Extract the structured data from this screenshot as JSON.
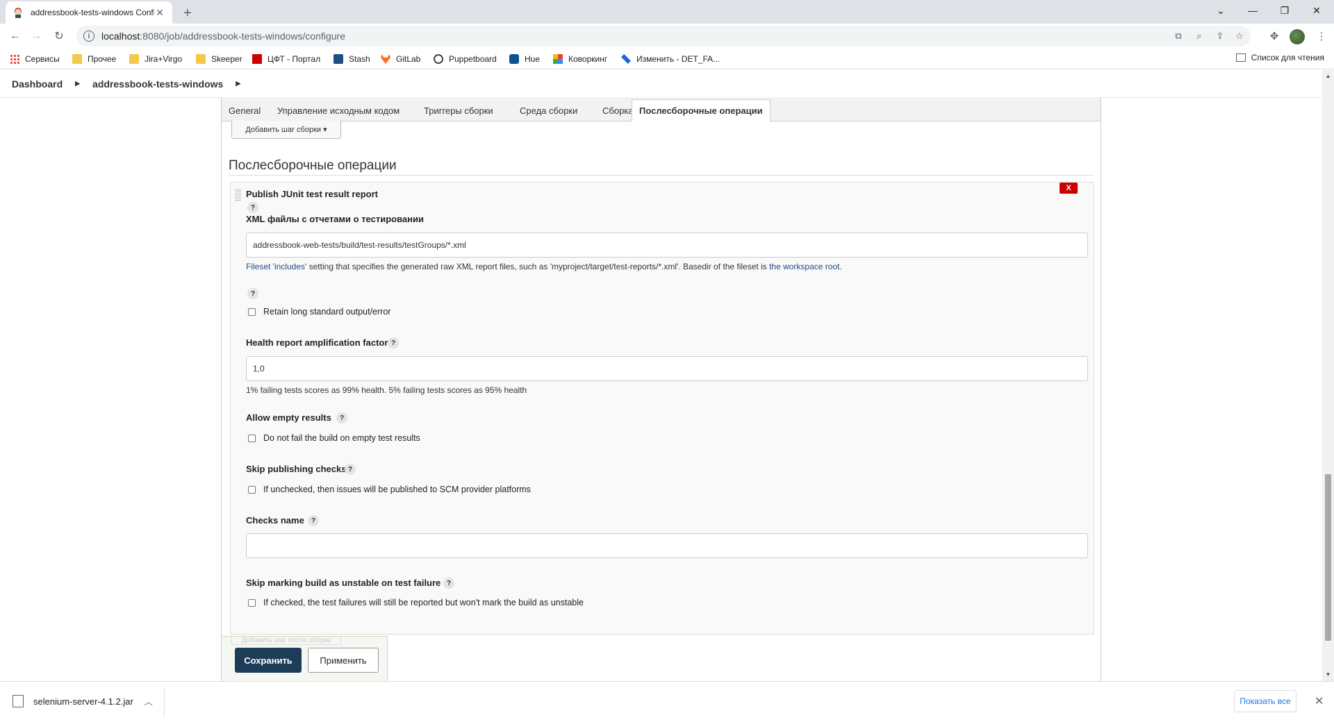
{
  "browser": {
    "tab_title": "addressbook-tests-windows Config",
    "url_host": "localhost",
    "url_path": ":8080/job/addressbook-tests-windows/configure",
    "bookmarks": [
      "Сервисы",
      "Прочее",
      "Jira+Virgo",
      "Skeeper",
      "ЦФТ - Портал",
      "Stash",
      "GitLab",
      "Puppetboard",
      "Hue",
      "Коворкинг",
      "Изменить - DET_FA..."
    ],
    "reading_list": "Список для чтения"
  },
  "breadcrumb": {
    "dashboard": "Dashboard",
    "job": "addressbook-tests-windows"
  },
  "tabs": [
    "General",
    "Управление исходным кодом",
    "Триггеры сборки",
    "Среда сборки",
    "Сборка",
    "Послесборочные операции"
  ],
  "add_build_step": "Добавить шаг сборки",
  "section_title": "Послесборочные операции",
  "publisher": {
    "title": "Publish JUnit test result report",
    "delete_label": "X",
    "help": "?",
    "xml_label": "XML файлы с отчетами о тестировании",
    "xml_value": "addressbook-web-tests/build/test-results/testGroups/*.xml",
    "xml_desc_link1": "Fileset 'includes'",
    "xml_desc_mid": " setting that specifies the generated raw XML report files, such as 'myproject/target/test-reports/*.xml'. Basedir of the fileset is ",
    "xml_desc_link2": "the workspace root",
    "xml_desc_end": ".",
    "retain_label": "Retain long standard output/error",
    "health_label": "Health report amplification factor",
    "health_value": "1,0",
    "health_desc": "1% failing tests scores as 99% health. 5% failing tests scores as 95% health",
    "allow_empty_label": "Allow empty results",
    "allow_empty_cb": "Do not fail the build on empty test results",
    "skip_publishing_label": "Skip publishing checks",
    "skip_publishing_cb": "If unchecked, then issues will be published to SCM provider platforms",
    "checks_name_label": "Checks name",
    "checks_name_value": "",
    "skip_unstable_label": "Skip marking build as unstable on test failure",
    "skip_unstable_cb": "If checked, the test failures will still be reported but won't mark the build as unstable"
  },
  "add_post_step": "Добавить шаг после сборки",
  "save": "Сохранить",
  "apply": "Применить",
  "downloads": {
    "file": "selenium-server-4.1.2.jar",
    "show_all": "Показать все"
  }
}
